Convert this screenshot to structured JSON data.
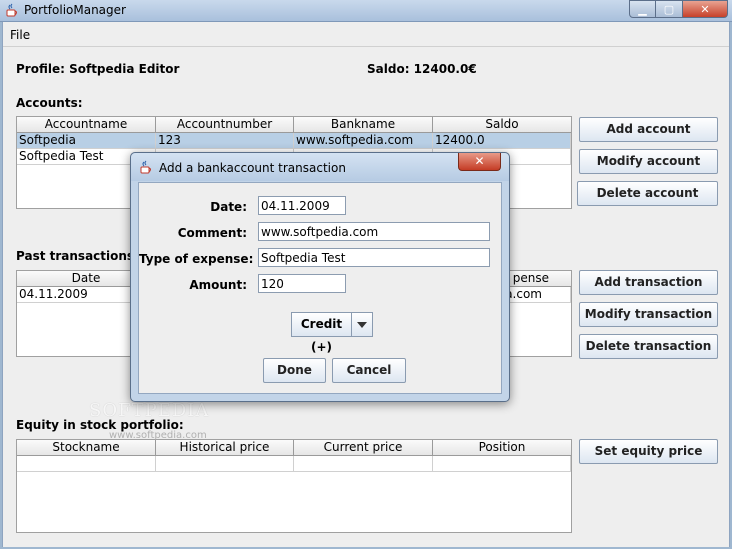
{
  "window": {
    "title": "PortfolioManager",
    "minimize_glyph": "▁",
    "maximize_glyph": "▢",
    "close_glyph": "✕"
  },
  "menu": {
    "file": "File"
  },
  "profile": {
    "label": "Profile: Softpedia Editor",
    "saldo": "Saldo: 12400.0€"
  },
  "accounts": {
    "label": "Accounts:",
    "columns": [
      "Accountname",
      "Accountnumber",
      "Bankname",
      "Saldo"
    ],
    "rows": [
      [
        "Softpedia",
        "123",
        "www.softpedia.com",
        "12400.0"
      ],
      [
        "Softpedia Test",
        "",
        "",
        ""
      ]
    ],
    "buttons": {
      "add": "Add account",
      "modify": "Modify account",
      "delete": "Delete account"
    }
  },
  "transactions": {
    "label": "Past transactions:",
    "columns": [
      "Date",
      "",
      "",
      "Type of expense"
    ],
    "visible_col4_header": "pense",
    "rows": [
      [
        "04.11.2009",
        "",
        "",
        "ia.com"
      ]
    ],
    "buttons": {
      "add": "Add transaction",
      "modify": "Modify transaction",
      "delete": "Delete transaction"
    }
  },
  "equity": {
    "label": "Equity in stock portfolio:",
    "columns": [
      "Stockname",
      "Historical price",
      "Current price",
      "Position"
    ],
    "buttons": {
      "set_price": "Set equity price"
    }
  },
  "watermark": {
    "brand": "SOFTPEDIA",
    "url": "www.softpedia.com"
  },
  "dialog": {
    "title": "Add a bankaccount transaction",
    "close_glyph": "✕",
    "fields": {
      "date_label": "Date:",
      "date_value": "04.11.2009",
      "comment_label": "Comment:",
      "comment_value": "www.softpedia.com",
      "type_label": "Type of expense:",
      "type_value": "Softpedia Test",
      "amount_label": "Amount:",
      "amount_value": "120"
    },
    "credit_select": "Credit (+)",
    "buttons": {
      "done": "Done",
      "cancel": "Cancel"
    }
  },
  "colors": {
    "selection": "#b8cfe5",
    "close_red": "#c43c25",
    "title_blue": "#b6cbe3"
  }
}
